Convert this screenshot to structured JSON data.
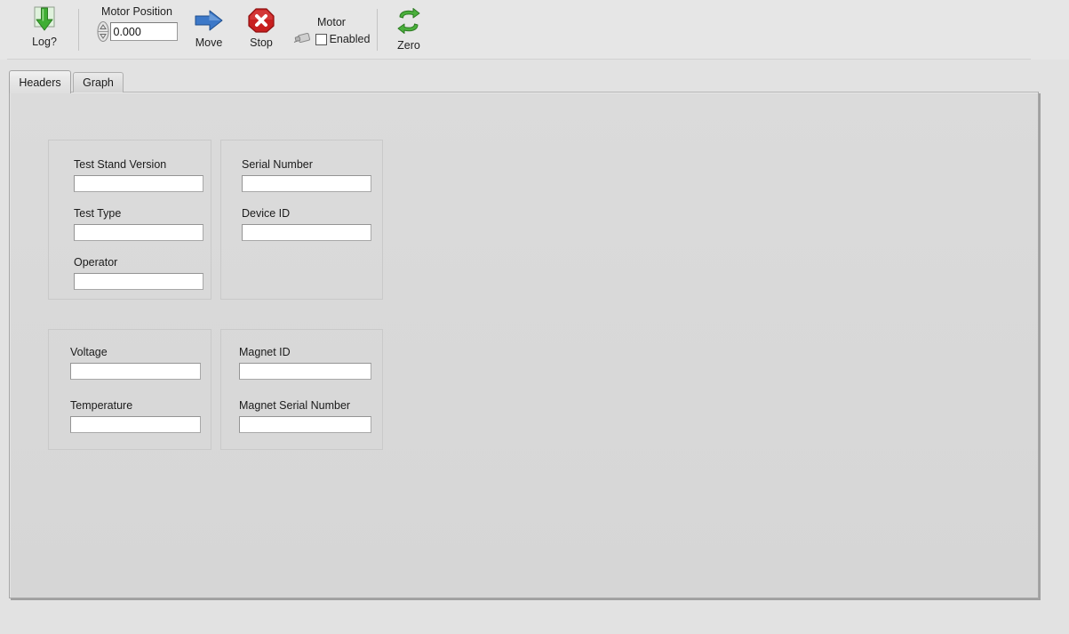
{
  "toolbar": {
    "log": {
      "label": "Log?",
      "icon": "download-arrow-icon"
    },
    "motor_position": {
      "label": "Motor Position",
      "value": "0.000",
      "placeholder": "",
      "spinner_icon": "spinner-updown-icon"
    },
    "move": {
      "label": "Move",
      "icon": "blue-right-arrow-icon"
    },
    "stop": {
      "label": "Stop",
      "icon": "red-octagon-x-icon"
    },
    "motor_enabled": {
      "title": "Motor",
      "checkbox_label": "Enabled",
      "checked": false,
      "icon": "motor-device-icon"
    },
    "zero": {
      "label": "Zero",
      "icon": "green-cycle-arrows-icon"
    }
  },
  "tabs": [
    {
      "id": "headers",
      "label": "Headers",
      "active": true
    },
    {
      "id": "graph",
      "label": "Graph",
      "active": false
    }
  ],
  "panel": {
    "groups": [
      {
        "id": "test-info",
        "fields": [
          {
            "id": "test-stand-version",
            "label": "Test Stand Version",
            "value": "",
            "placeholder": ""
          },
          {
            "id": "test-type",
            "label": "Test Type",
            "value": "",
            "placeholder": ""
          },
          {
            "id": "operator",
            "label": "Operator",
            "value": "",
            "placeholder": ""
          }
        ]
      },
      {
        "id": "device-info",
        "fields": [
          {
            "id": "serial-number",
            "label": "Serial Number",
            "value": "",
            "placeholder": ""
          },
          {
            "id": "device-id",
            "label": "Device ID",
            "value": "",
            "placeholder": ""
          }
        ]
      },
      {
        "id": "measurement",
        "fields": [
          {
            "id": "voltage",
            "label": "Voltage",
            "value": "",
            "placeholder": ""
          },
          {
            "id": "temperature",
            "label": "Temperature",
            "value": "",
            "placeholder": ""
          }
        ]
      },
      {
        "id": "magnet",
        "fields": [
          {
            "id": "magnet-id",
            "label": "Magnet ID",
            "value": "",
            "placeholder": ""
          },
          {
            "id": "magnet-serial-number",
            "label": "Magnet Serial Number",
            "value": "",
            "placeholder": ""
          }
        ]
      }
    ]
  },
  "colors": {
    "window_bg": "#e2e2e2",
    "toolbar_bg": "#e6e6e6",
    "panel_bg": "#d7d7d7",
    "accent_green": "#3aa832",
    "accent_blue": "#2e6fc4",
    "accent_red": "#cc2222"
  }
}
